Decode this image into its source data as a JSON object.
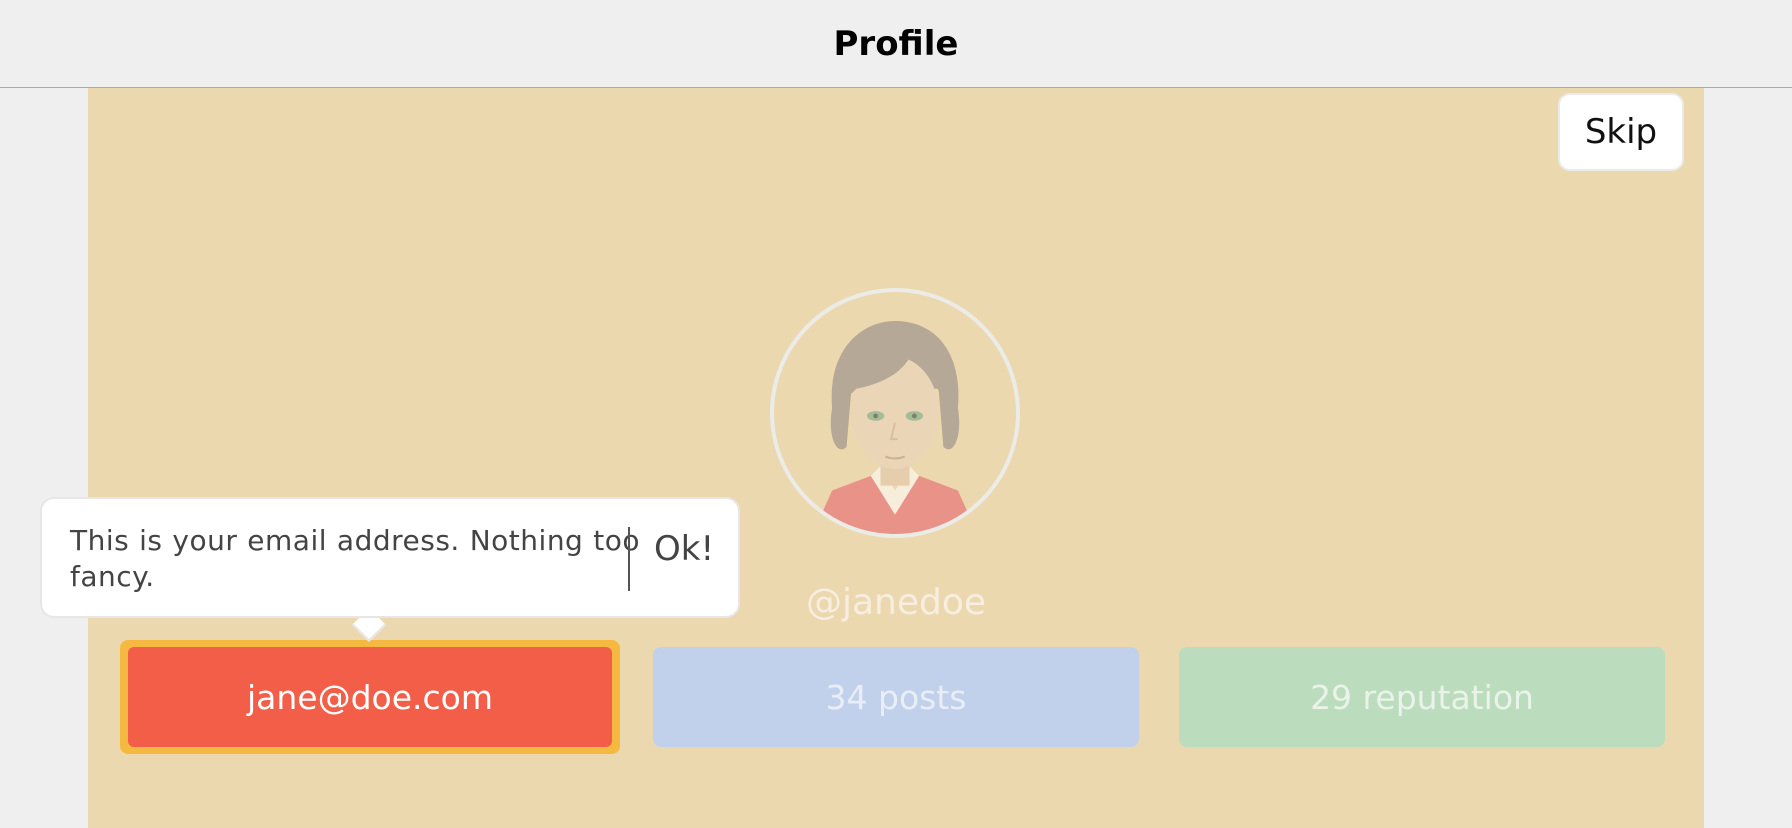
{
  "header": {
    "title": "Profile"
  },
  "toolbar": {
    "skip_label": "Skip"
  },
  "profile": {
    "username": "@janedoe",
    "avatar_icon": "avatar-woman-icon"
  },
  "stats": {
    "email": "jane@doe.com",
    "posts": "34 posts",
    "reputation": "29 reputation"
  },
  "tooltip": {
    "text": "This is your email address. Nothing too fancy.",
    "ok_label": "Ok!"
  },
  "colors": {
    "content_bg": "#ecd8ae",
    "email_bg": "#f35e48",
    "email_highlight": "#f5b942",
    "posts_bg": "#c2d1eb",
    "reputation_bg": "#bbdcbd"
  }
}
